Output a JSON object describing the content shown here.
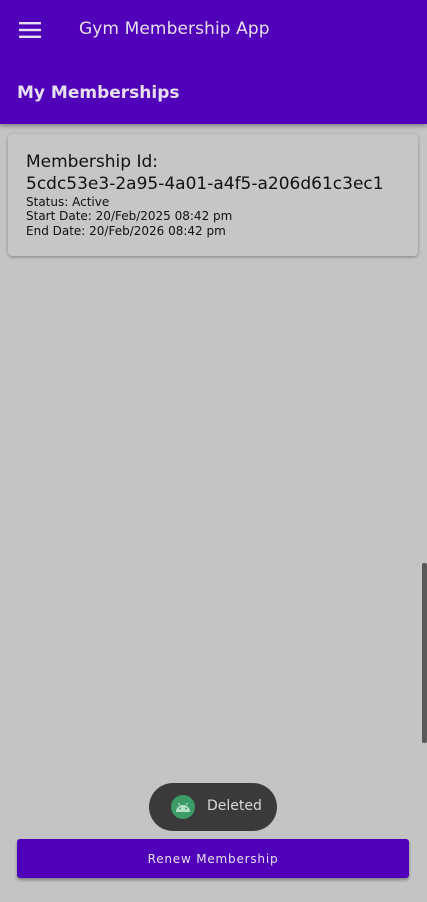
{
  "app_bar": {
    "title": "Gym Membership App",
    "menu_icon": "hamburger-menu-icon"
  },
  "sub_header": {
    "title": "My Memberships"
  },
  "memberships": [
    {
      "id_label": "Membership Id:",
      "id_value": "5cdc53e3-2a95-4a01-a4f5-a206d61c3ec1",
      "status": "Status: Active",
      "start_date": "Start Date: 20/Feb/2025 08:42 pm",
      "end_date": "End Date: 20/Feb/2026 08:42 pm"
    }
  ],
  "toast": {
    "icon": "android-icon",
    "text": "Deleted"
  },
  "footer": {
    "renew_label": "Renew Membership"
  },
  "colors": {
    "primary": "#5000b8",
    "background": "#c4c4c4",
    "toast_bg": "#3a3a3a"
  }
}
